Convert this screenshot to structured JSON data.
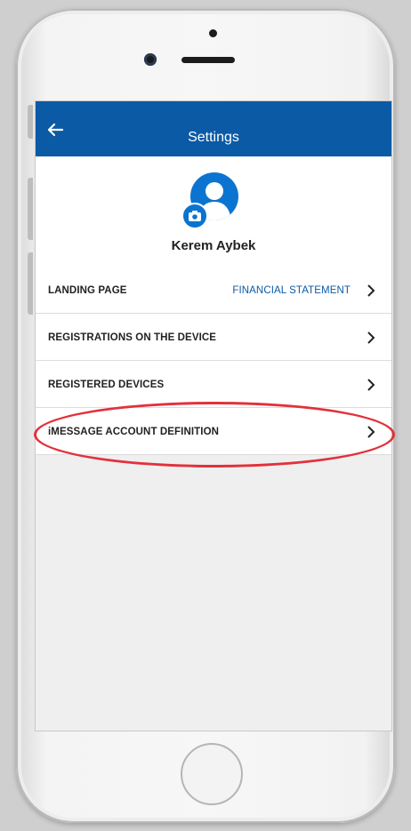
{
  "header": {
    "title": "Settings"
  },
  "profile": {
    "name": "Kerem Aybek"
  },
  "settings": [
    {
      "label": "LANDING PAGE",
      "value": "FINANCIAL STATEMENT"
    },
    {
      "label": "REGISTRATIONS ON THE DEVICE",
      "value": ""
    },
    {
      "label": "REGISTERED DEVICES",
      "value": ""
    },
    {
      "label": "iMESSAGE ACCOUNT DEFINITION",
      "value": ""
    }
  ],
  "colors": {
    "accent": "#0b5aa6",
    "highlight": "#e2313b"
  },
  "icons": {
    "back": "arrow-left-icon",
    "chevron": "chevron-right-icon",
    "camera": "camera-icon",
    "avatar": "user-avatar-icon"
  }
}
